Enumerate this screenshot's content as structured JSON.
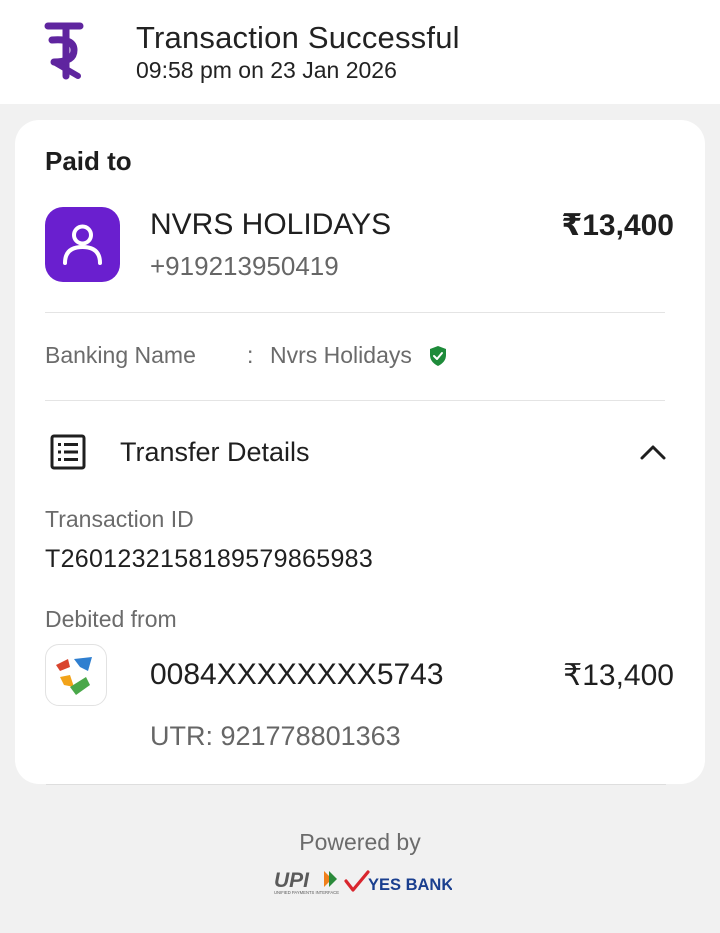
{
  "header": {
    "title": "Transaction Successful",
    "datetime": "09:58 pm on 23 Jan 2026",
    "logo_icon": "phonepe-logo",
    "brand_color": "#5f259f"
  },
  "payee": {
    "section_label": "Paid to",
    "name": "NVRS HOLIDAYS",
    "phone": "+919213950419",
    "amount": "₹13,400",
    "avatar_icon": "user-avatar-icon",
    "avatar_color": "#6a1fcf"
  },
  "banking_name": {
    "label": "Banking Name",
    "separator": ":",
    "value": "Nvrs Holidays",
    "verified_icon": "verified-shield-icon",
    "verified_color": "#1e8b3a"
  },
  "transfer_details": {
    "title": "Transfer Details",
    "icon": "receipt-list-icon",
    "toggle_icon": "chevron-up-icon",
    "transaction_id_label": "Transaction ID",
    "transaction_id": "T2601232158189579865983",
    "debited_from_label": "Debited from",
    "account_number": "0084XXXXXXXX5743",
    "debited_amount": "₹13,400",
    "utr": "UTR: 921778801363",
    "bank_icon": "bank-logo-icon"
  },
  "footer": {
    "powered_by": "Powered by",
    "logos": [
      "UPI",
      "YES BANK"
    ],
    "upi_tagline": "UNIFIED PAYMENTS INTERFACE"
  }
}
